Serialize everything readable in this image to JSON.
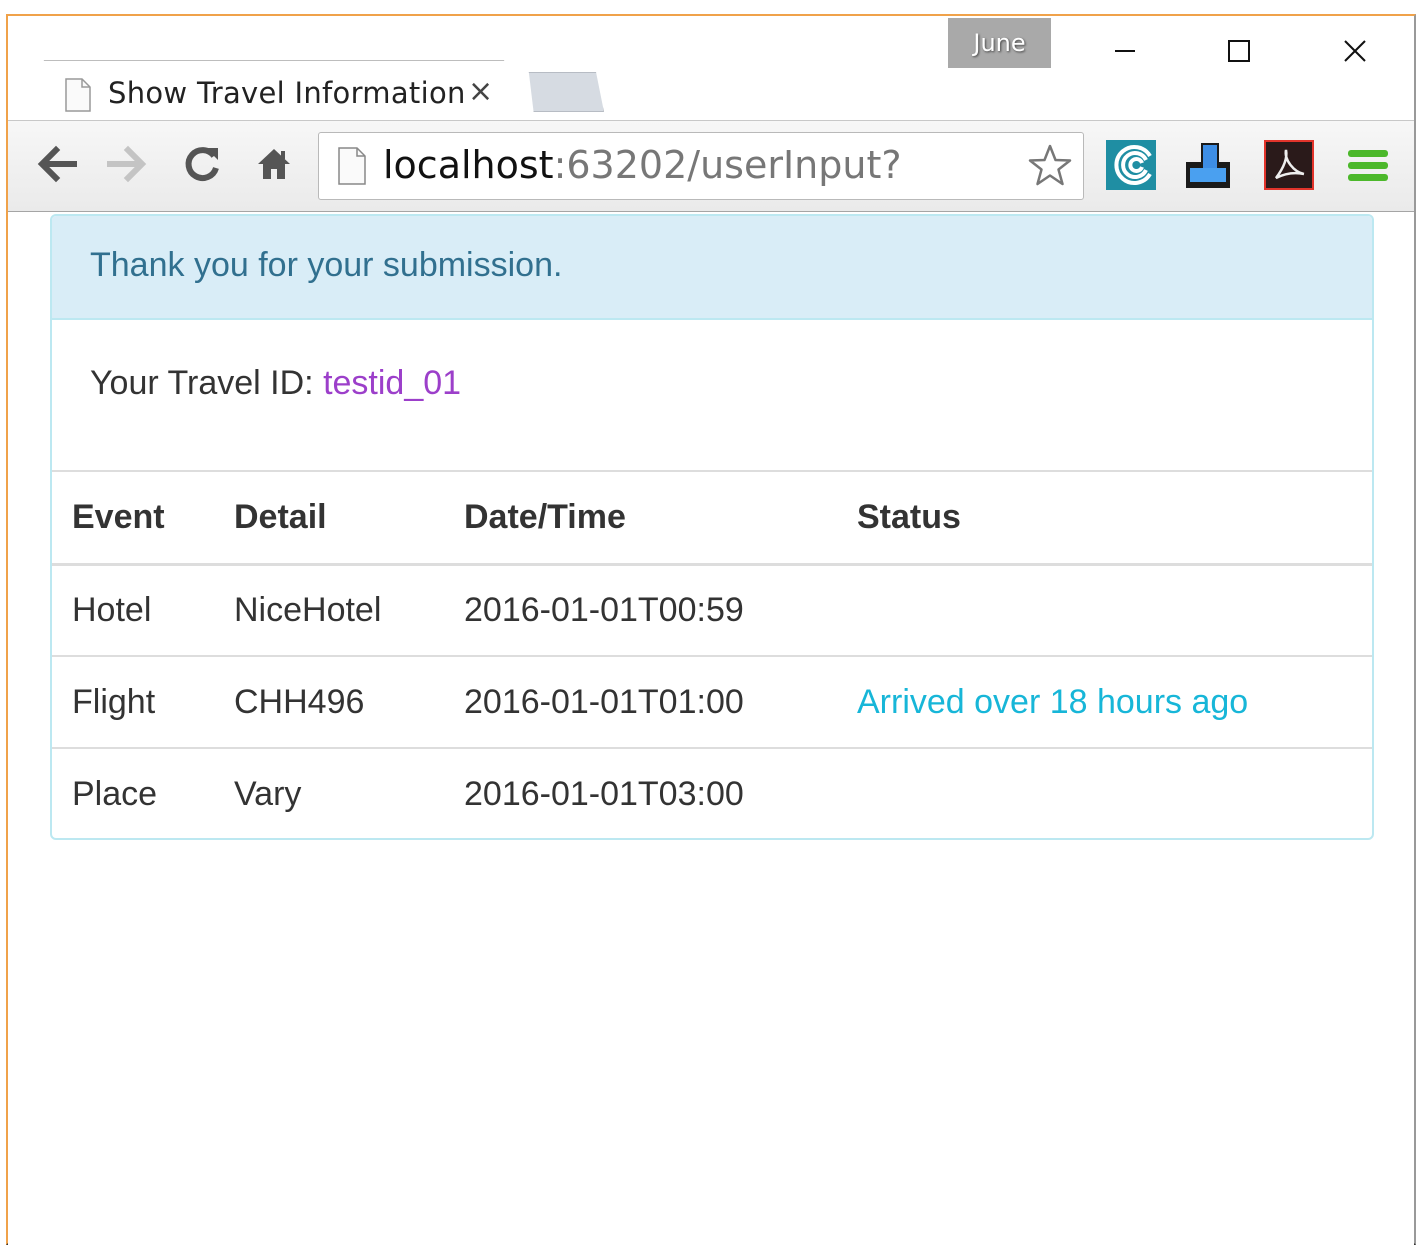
{
  "window": {
    "profile_name": "June"
  },
  "tabs": [
    {
      "title": "Show Travel Information",
      "close_glyph": "×"
    }
  ],
  "toolbar": {
    "url_host": "localhost",
    "url_path": ":63202/userInput?"
  },
  "alert": {
    "message": "Thank you for your submission."
  },
  "travel": {
    "id_label": "Your Travel ID: ",
    "id_value": "testid_01"
  },
  "table": {
    "headers": [
      "Event",
      "Detail",
      "Date/Time",
      "Status"
    ],
    "rows": [
      {
        "event": "Hotel",
        "detail": "NiceHotel",
        "datetime": "2016-01-01T00:59",
        "status": ""
      },
      {
        "event": "Flight",
        "detail": "CHH496",
        "datetime": "2016-01-01T01:00",
        "status": "Arrived over 18 hours ago"
      },
      {
        "event": "Place",
        "detail": "Vary",
        "datetime": "2016-01-01T03:00",
        "status": ""
      }
    ]
  },
  "colors": {
    "window_border": "#f0a24a",
    "alert_bg": "#d9edf7",
    "alert_text": "#31708f",
    "travel_id": "#9c3fca",
    "status_info": "#17b6d8",
    "menu_green": "#4cb82b"
  },
  "icons": [
    "page-icon",
    "close-icon",
    "minimize-icon",
    "maximize-icon",
    "back-icon",
    "forward-icon",
    "reload-icon",
    "home-icon",
    "star-icon",
    "extension-icon",
    "hamburger-menu-icon"
  ]
}
